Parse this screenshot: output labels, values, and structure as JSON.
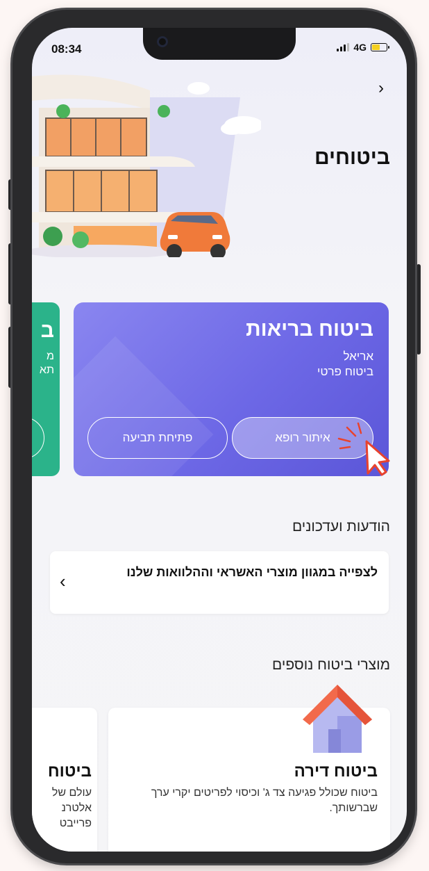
{
  "status_bar": {
    "time": "08:34",
    "network": "4G"
  },
  "header": {
    "title": "ביטוחים"
  },
  "policy_cards": [
    {
      "title": "ביטוח בריאות",
      "insurer": "אריאל",
      "type": "ביטוח פרטי",
      "primary_button": "איתור רופא",
      "secondary_button": "פתיחת תביעה",
      "color": "#6d68e6"
    },
    {
      "title": "ב",
      "line1": "מ",
      "line2": "תא",
      "color": "#2bb38a"
    }
  ],
  "notices": {
    "title": "הודעות ועדכונים",
    "items": [
      {
        "text": "לצפייה במגוון מוצרי האשראי וההלוואות שלנו"
      }
    ]
  },
  "more_products": {
    "title": "מוצרי ביטוח נוספים",
    "items": [
      {
        "title": "ביטוח דירה",
        "description": "ביטוח שכולל פגיעה צד ג' וכיסוי לפריטים יקרי ערך שברשותך."
      },
      {
        "title": "ביטוח",
        "description": "עולם של אלטרנ פרייבט"
      }
    ]
  },
  "colors": {
    "accent": "#6d68e6",
    "green": "#2bb38a",
    "cursor": "#e8432e",
    "house_roof": "#f26a4b"
  }
}
